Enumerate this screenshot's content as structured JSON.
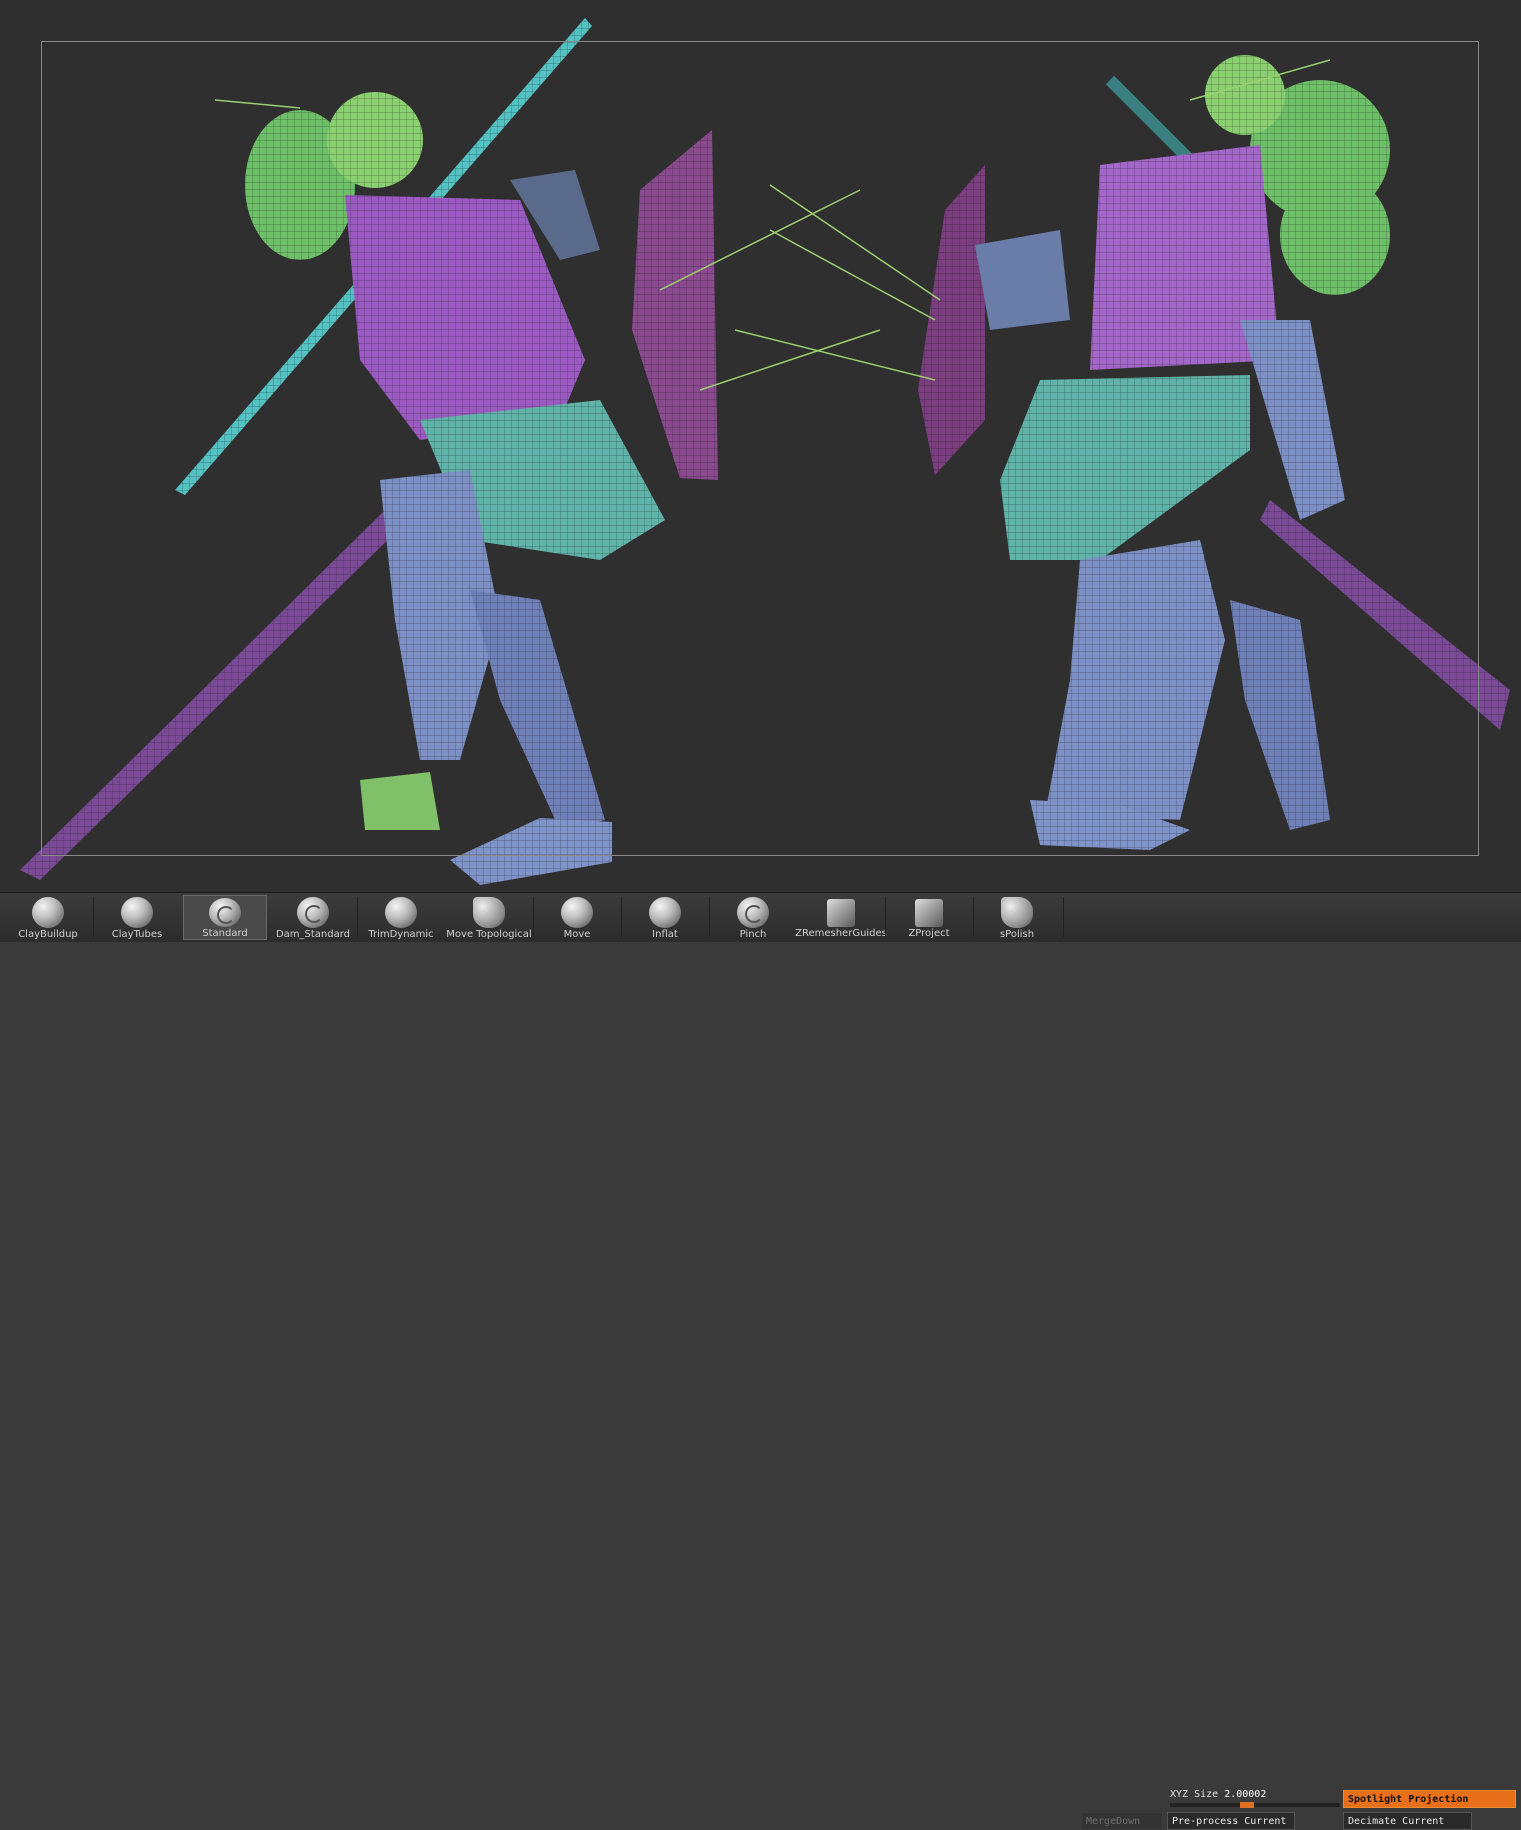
{
  "brushes": [
    {
      "label": "ClayBuildup",
      "icon": "sphere-icon",
      "active": false
    },
    {
      "label": "ClayTubes",
      "icon": "sphere-icon",
      "active": false
    },
    {
      "label": "Standard",
      "icon": "swirl-sphere-icon",
      "active": true
    },
    {
      "label": "Dam_Standard",
      "icon": "swirl-sphere-icon",
      "active": false
    },
    {
      "label": "TrimDynamic",
      "icon": "sphere-icon",
      "active": false
    },
    {
      "label": "Move Topological",
      "icon": "flat-sphere-icon",
      "active": false
    },
    {
      "label": "Move",
      "icon": "sphere-icon",
      "active": false
    },
    {
      "label": "Inflat",
      "icon": "sphere-icon",
      "active": false
    },
    {
      "label": "Pinch",
      "icon": "swirl-sphere-icon",
      "active": false
    },
    {
      "label": "ZRemesherGuides",
      "icon": "cube-icon",
      "active": false
    },
    {
      "label": "ZProject",
      "icon": "cube-icon",
      "active": false
    },
    {
      "label": "sPolish",
      "icon": "flat-sphere-icon",
      "active": false
    }
  ],
  "xyz": {
    "label": "XYZ Size",
    "value": "2.00002"
  },
  "buttons": {
    "mergedown": "MergeDown",
    "preprocess": "Pre-process Current",
    "spotlight": "Spotlight Projection",
    "decimate": "Decimate Current"
  },
  "colors": {
    "accent": "#e8701a",
    "viewport_bg": "#2f2f2f",
    "mesh_green": "#7ec46a",
    "mesh_purple": "#9a5cc0",
    "mesh_teal": "#5fb3ad",
    "mesh_blue": "#7b8fc0"
  }
}
